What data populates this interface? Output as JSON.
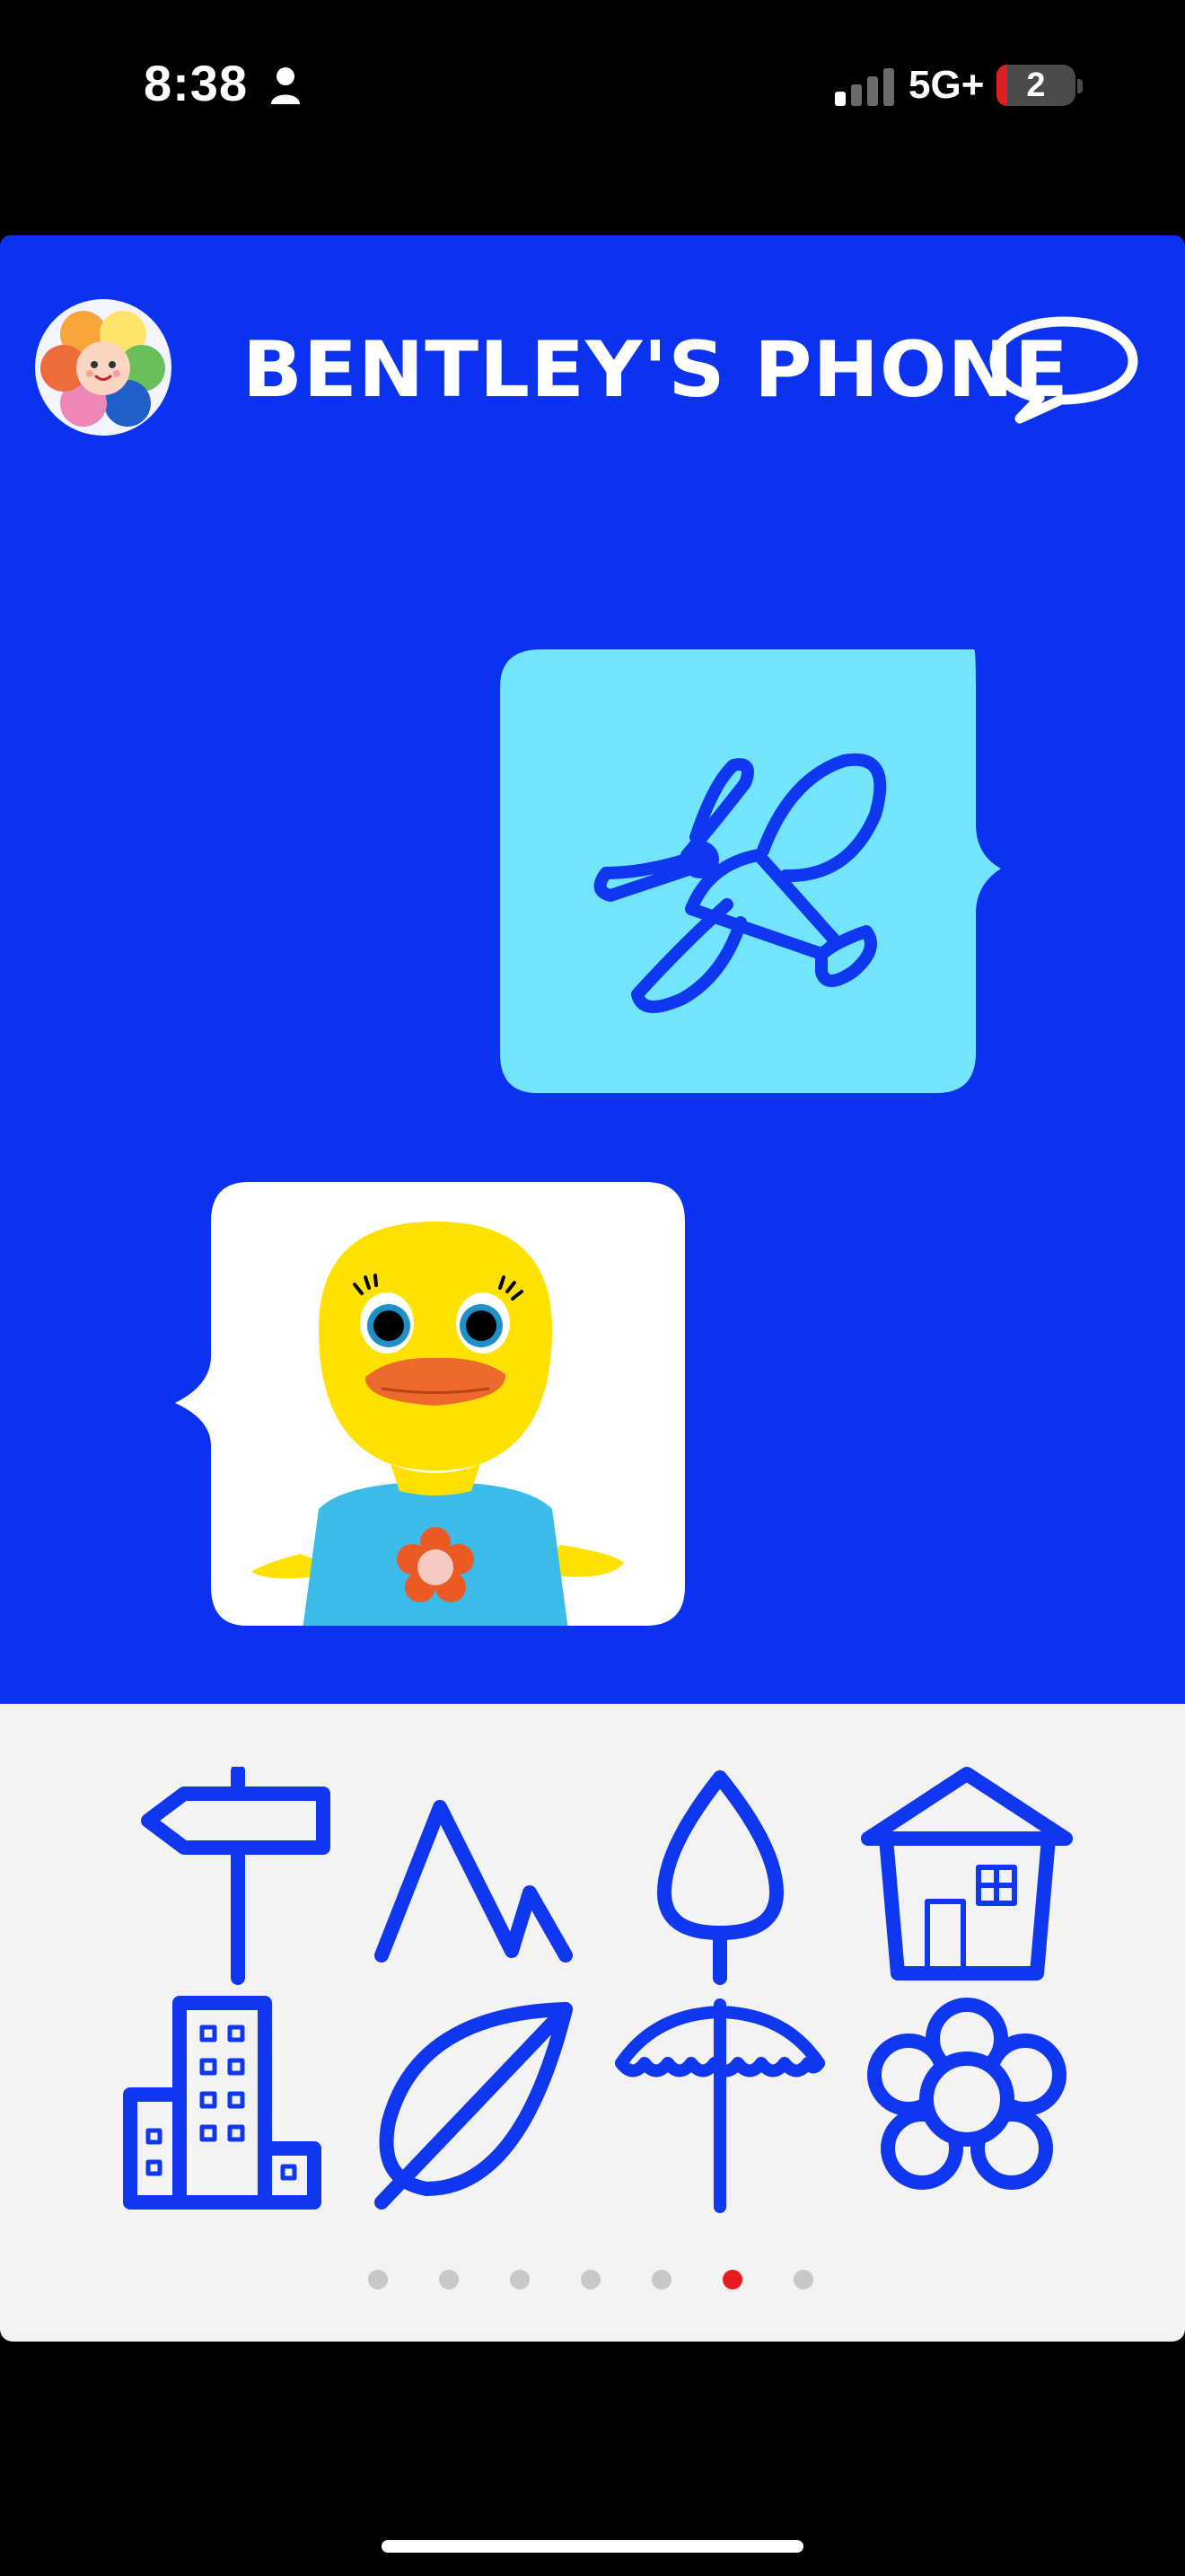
{
  "status_bar": {
    "time": "8:38",
    "network": "5G+",
    "battery_level": "2"
  },
  "header": {
    "title": "BENTLEY'S PHONE",
    "logo_icon": "rainbow-flower-face-icon",
    "chat_icon": "speech-bubble-icon"
  },
  "messages": [
    {
      "direction": "outgoing",
      "content_icon": "airplane-icon",
      "bubble_color": "#72e4fb"
    },
    {
      "direction": "incoming",
      "content_icon": "duck-character",
      "bubble_color": "#ffffff"
    }
  ],
  "keyboard": {
    "icons": [
      "signpost-icon",
      "mountains-icon",
      "tree-icon",
      "house-icon",
      "building-icon",
      "leaf-icon",
      "umbrella-icon",
      "flower-icon"
    ],
    "page_count": 7,
    "active_page": 6
  },
  "colors": {
    "app_blue": "#0a32ef",
    "icon_blue": "#0f37ef",
    "keyboard_bg": "#f3f3f4",
    "active_dot": "#e81c1c"
  }
}
